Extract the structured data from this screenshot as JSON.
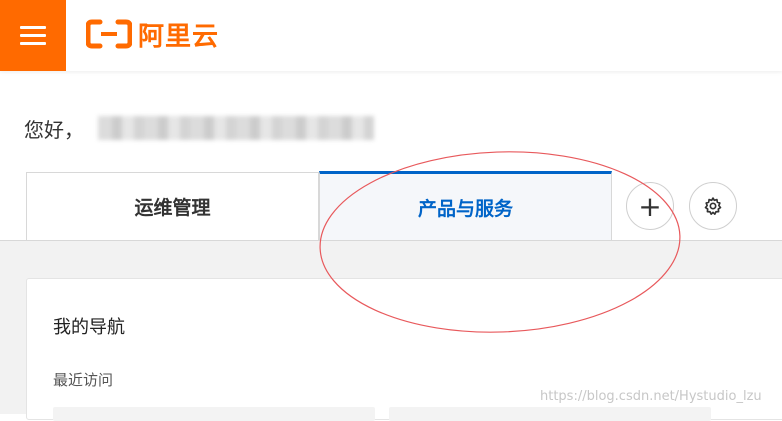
{
  "header": {
    "menu_icon": "hamburger-menu-icon",
    "logo_text": "阿里云",
    "brand_color": "#ff6a00"
  },
  "greeting": {
    "text": "您好，"
  },
  "tabs": [
    {
      "label": "运维管理",
      "active": false
    },
    {
      "label": "产品与服务",
      "active": true
    }
  ],
  "tab_actions": {
    "add_symbol": "+",
    "settings_icon": "gear-icon"
  },
  "accent_color": "#0064c8",
  "nav_card": {
    "title": "我的导航",
    "recent_label": "最近访问"
  },
  "watermark": "https://blog.csdn.net/Hystudio_lzu"
}
